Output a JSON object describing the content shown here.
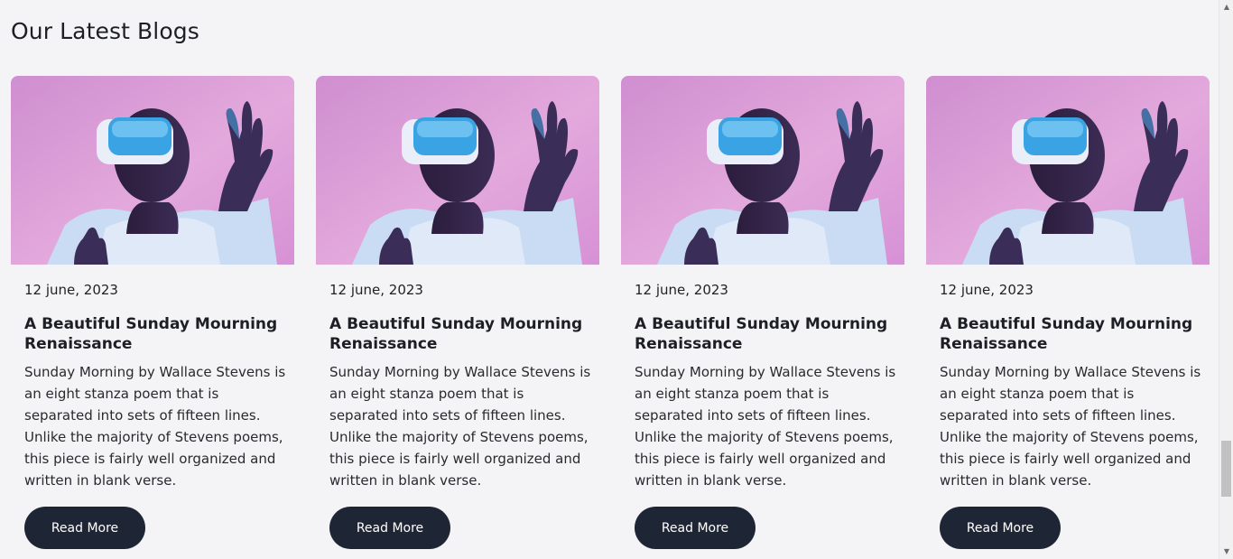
{
  "section": {
    "title": "Our Latest Blogs"
  },
  "colors": {
    "background": "#f4f4f6",
    "button": "#1e2535",
    "image_bg": "#d99ad6"
  },
  "cards": [
    {
      "image": "vr-headset-person-photo",
      "date": "12 june, 2023",
      "title": "A Beautiful Sunday Mourning Renaissance",
      "excerpt": "Sunday Morning by Wallace Stevens is an eight stanza poem that is separated into sets of fifteen lines. Unlike the majority of Stevens poems, this piece is fairly well organized and written in blank verse.",
      "button_label": "Read More"
    },
    {
      "image": "vr-headset-person-photo",
      "date": "12 june, 2023",
      "title": "A Beautiful Sunday Mourning Renaissance",
      "excerpt": "Sunday Morning by Wallace Stevens is an eight stanza poem that is separated into sets of fifteen lines. Unlike the majority of Stevens poems, this piece is fairly well organized and written in blank verse.",
      "button_label": "Read More"
    },
    {
      "image": "vr-headset-person-photo",
      "date": "12 june, 2023",
      "title": "A Beautiful Sunday Mourning Renaissance",
      "excerpt": "Sunday Morning by Wallace Stevens is an eight stanza poem that is separated into sets of fifteen lines. Unlike the majority of Stevens poems, this piece is fairly well organized and written in blank verse.",
      "button_label": "Read More"
    },
    {
      "image": "vr-headset-person-photo",
      "date": "12 june, 2023",
      "title": "A Beautiful Sunday Mourning Renaissance",
      "excerpt": "Sunday Morning by Wallace Stevens is an eight stanza poem that is separated into sets of fifteen lines. Unlike the majority of Stevens poems, this piece is fairly well organized and written in blank verse.",
      "button_label": "Read More"
    }
  ]
}
